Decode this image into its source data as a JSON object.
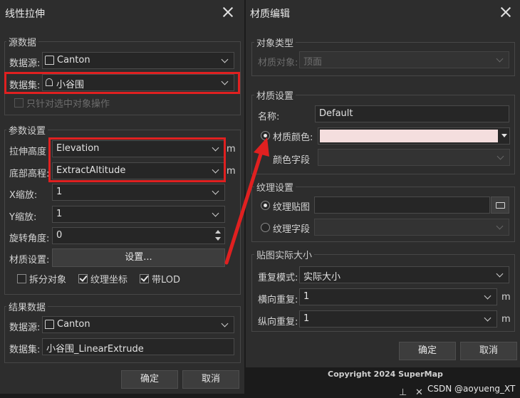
{
  "left_dialog": {
    "title": "线性拉伸",
    "source_group": {
      "title": "源数据",
      "datasource_label": "数据源:",
      "datasource_value": "Canton",
      "dataset_label": "数据集:",
      "dataset_value": "小谷围",
      "only_selected_label": "只针对选中对象操作"
    },
    "params_group": {
      "title": "参数设置",
      "extrude_height_label": "拉伸高度",
      "extrude_height_value": "Elevation",
      "base_elevation_label": "底部高程:",
      "base_elevation_value": "ExtractAltitude",
      "unit": "m",
      "x_scale_label": "X缩放:",
      "x_scale_value": "1",
      "y_scale_label": "Y缩放:",
      "y_scale_value": "1",
      "rotation_label": "旋转角度:",
      "rotation_value": "0",
      "material_label": "材质设置:",
      "material_button": "设置...",
      "split_objects_label": "拆分对象",
      "texture_coords_label": "纹理坐标",
      "lod_label": "带LOD"
    },
    "result_group": {
      "title": "结果数据",
      "datasource_label": "数据源:",
      "datasource_value": "Canton",
      "dataset_label": "数据集:",
      "dataset_value": "小谷围_LinearExtrude"
    },
    "ok_button": "确定",
    "cancel_button": "取消"
  },
  "right_dialog": {
    "title": "材质编辑",
    "object_type_group": {
      "title": "对象类型",
      "material_object_label": "材质对象:",
      "material_object_value": "顶面"
    },
    "material_group": {
      "title": "材质设置",
      "name_label": "名称:",
      "name_value": "Default",
      "material_color_label": "材质颜色:",
      "material_color": "#f4dede",
      "color_field_label": "颜色字段"
    },
    "texture_group": {
      "title": "纹理设置",
      "texture_map_label": "纹理贴图",
      "texture_field_label": "纹理字段"
    },
    "real_size_group": {
      "title": "贴图实际大小",
      "repeat_mode_label": "重复模式:",
      "repeat_mode_value": "实际大小",
      "h_repeat_label": "横向重复:",
      "h_repeat_value": "1",
      "v_repeat_label": "纵向重复:",
      "v_repeat_value": "1",
      "unit": "m"
    },
    "ok_button": "确定",
    "cancel_button": "取消"
  },
  "footer": {
    "copyright": "Copyright 2024 SuperMap",
    "watermark": "CSDN @aoyueng_XT",
    "pin_icon": "pin-icon",
    "close_icon": "close-icon"
  },
  "colors": {
    "dialog_bg": "#2d2d2d",
    "highlight": "#e02020",
    "arrow": "#e02020"
  }
}
